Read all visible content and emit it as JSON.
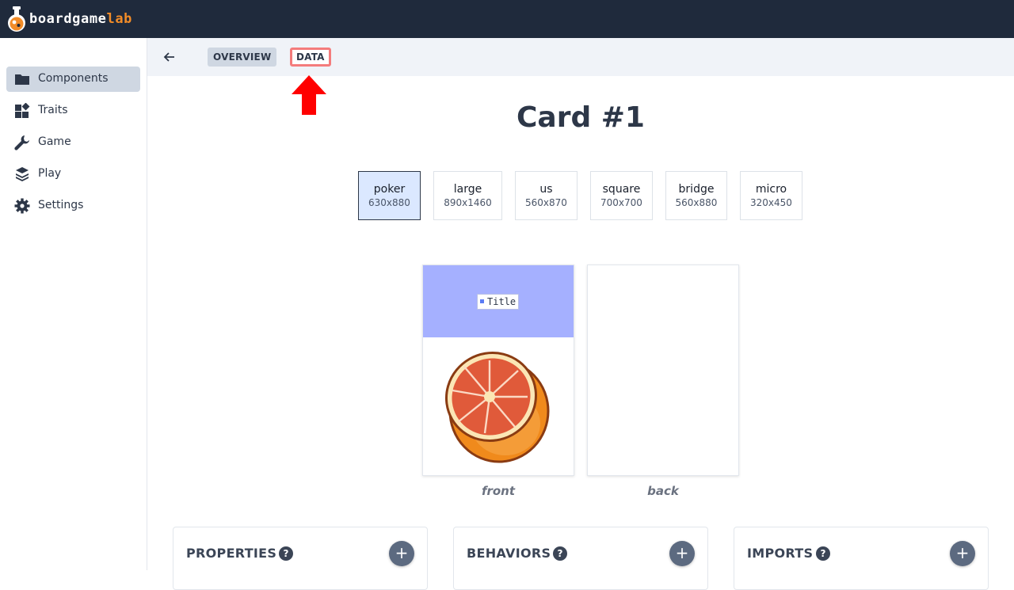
{
  "app": {
    "logo_part1": "boardgame",
    "logo_part2": "lab",
    "brand_color": "#f28c28",
    "header_color": "#1f2a3c"
  },
  "sidebar": {
    "items": [
      {
        "label": "Components",
        "icon": "folder-icon",
        "active": true
      },
      {
        "label": "Traits",
        "icon": "widgets-icon",
        "active": false
      },
      {
        "label": "Game",
        "icon": "wrench-icon",
        "active": false
      },
      {
        "label": "Play",
        "icon": "layers-icon",
        "active": false
      },
      {
        "label": "Settings",
        "icon": "gear-icon",
        "active": false
      }
    ]
  },
  "subbar": {
    "back_icon": "arrow-left-icon",
    "tabs": [
      {
        "label": "OVERVIEW",
        "active": true
      },
      {
        "label": "DATA",
        "highlighted": true
      }
    ],
    "annotation": "red-up-arrow-icon"
  },
  "main": {
    "title": "Card #1",
    "sizes": [
      {
        "name": "poker",
        "dims": "630x880",
        "selected": true
      },
      {
        "name": "large",
        "dims": "890x1460",
        "selected": false
      },
      {
        "name": "us",
        "dims": "560x870",
        "selected": false
      },
      {
        "name": "square",
        "dims": "700x700",
        "selected": false
      },
      {
        "name": "bridge",
        "dims": "560x880",
        "selected": false
      },
      {
        "name": "micro",
        "dims": "320x450",
        "selected": false
      }
    ],
    "front": {
      "label": "front",
      "title_chip": "Title",
      "band_color": "#a5b0ff",
      "image": "orange-half-icon"
    },
    "back": {
      "label": "back"
    },
    "panels": [
      {
        "title": "PROPERTIES",
        "help": "?",
        "add": "+"
      },
      {
        "title": "BEHAVIORS",
        "help": "?",
        "add": "+"
      },
      {
        "title": "IMPORTS",
        "help": "?",
        "add": "+"
      }
    ]
  }
}
